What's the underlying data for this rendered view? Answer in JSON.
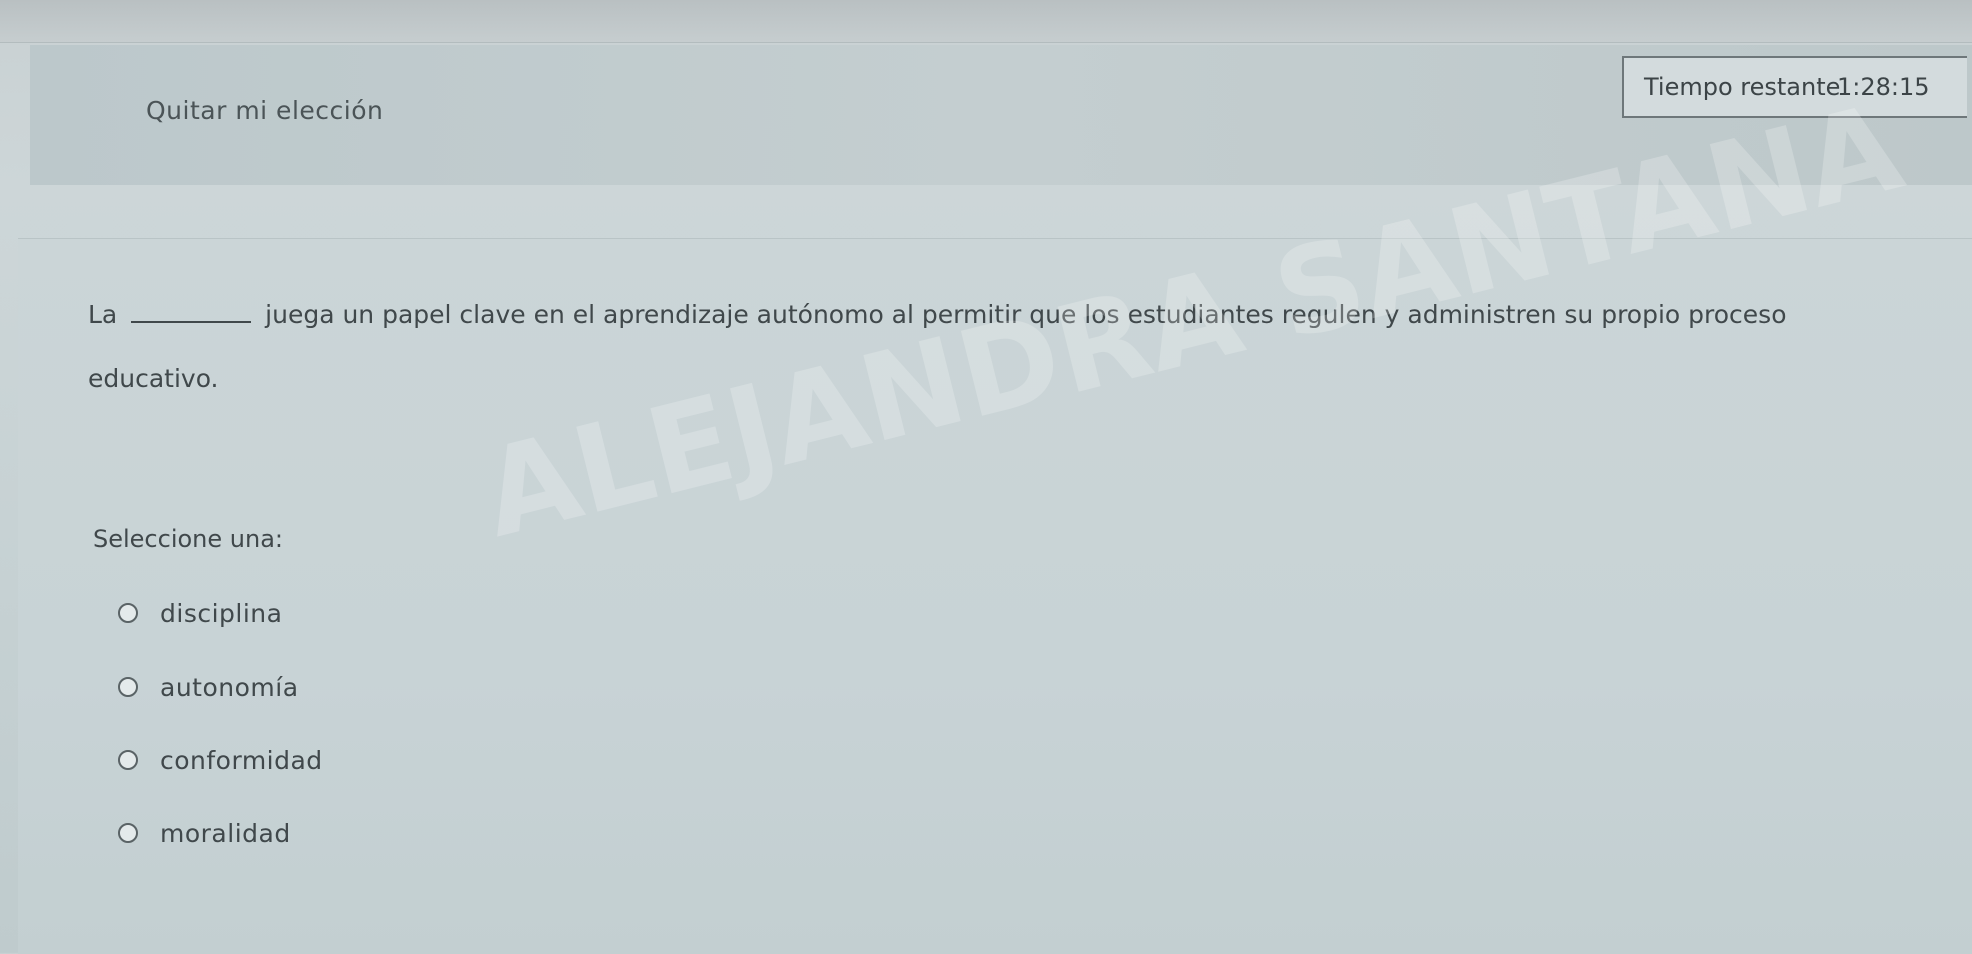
{
  "header": {
    "clear_choice": "Quitar mi elección",
    "timer_label": "Tiempo restante",
    "timer_value": "1:28:15"
  },
  "question": {
    "text_before_blank": "La",
    "text_after_blank": "juega un papel clave en el aprendizaje autónomo al permitir que los estudiantes regulen y administren su propio proceso educativo.",
    "select_prompt": "Seleccione una:",
    "options": [
      {
        "label": "disciplina"
      },
      {
        "label": "autonomía"
      },
      {
        "label": "conformidad"
      },
      {
        "label": "moralidad"
      }
    ]
  },
  "watermark": {
    "text": "ALEJANDRA SANTANA"
  },
  "colors": {
    "background": "#c9d3d5",
    "text": "#40484b",
    "timer_border": "#6e777a"
  }
}
